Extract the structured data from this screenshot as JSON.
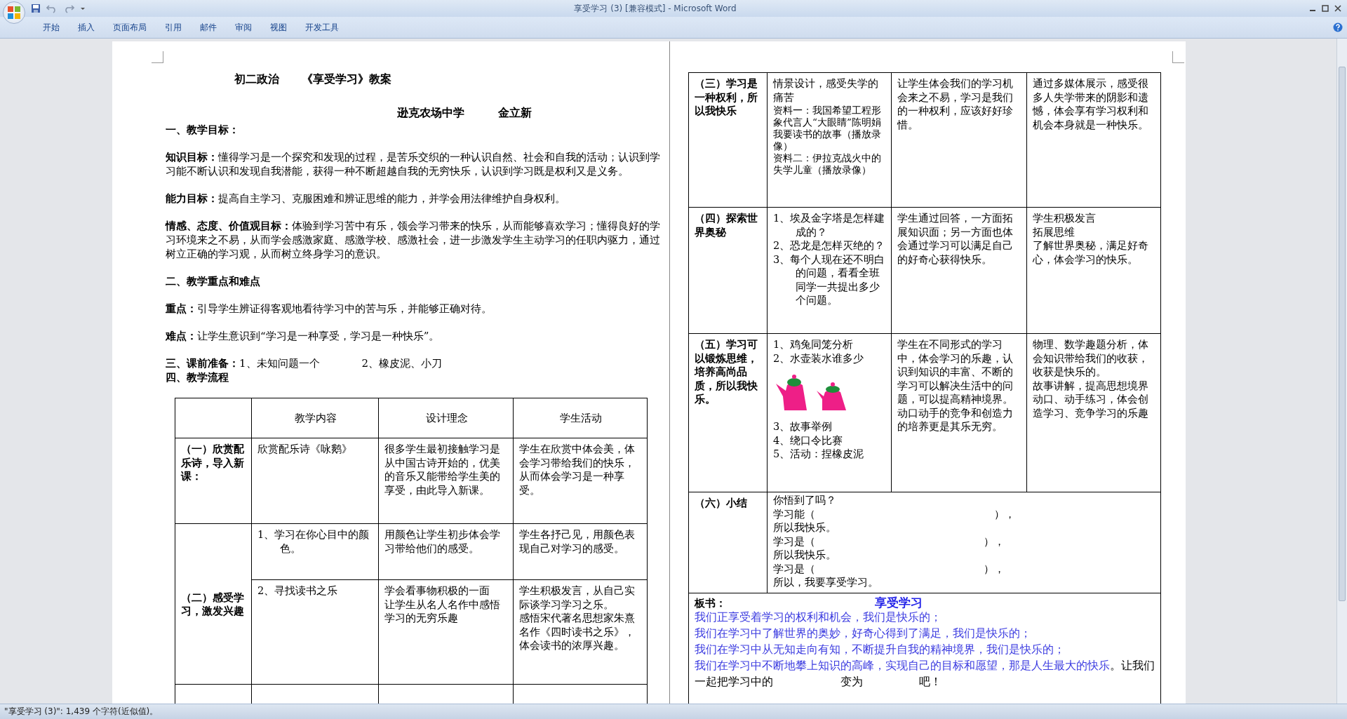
{
  "window": {
    "title": "享受学习 (3) [兼容模式] - Microsoft Word"
  },
  "ribbon_tabs": [
    {
      "label": "开始",
      "selected": false
    },
    {
      "label": "插入",
      "selected": false
    },
    {
      "label": "页面布局",
      "selected": false
    },
    {
      "label": "引用",
      "selected": false
    },
    {
      "label": "邮件",
      "selected": false
    },
    {
      "label": "审阅",
      "selected": false
    },
    {
      "label": "视图",
      "selected": false
    },
    {
      "label": "开发工具",
      "selected": false
    }
  ],
  "document": {
    "title": "初二政治　　《享受学习》教案",
    "byline": "逊克农场中学　　　金立新",
    "paragraphs": [
      {
        "kind": "section",
        "text": "一、教学目标："
      },
      {
        "kind": "para",
        "text": "**知识目标：**懂得学习是一个探究和发现的过程，是苦乐交织的一种认识自然、社会和自我的活动；认识到学习能不断认识和发现自我潜能，获得一种不断超越自我的无穷快乐，认识到学习既是权利又是义务。"
      },
      {
        "kind": "para",
        "text": "**能力目标：**提高自主学习、克服困难和辨证思维的能力，并学会用法律维护自身权利。"
      },
      {
        "kind": "para",
        "text": "**情感、态度、价值观目标：**体验到学习苦中有乐，领会学习带来的快乐，从而能够喜欢学习；懂得良好的学习环境来之不易，从而学会感激家庭、感激学校、感激社会，进一步激发学生主动学习的任职内驱力，通过树立正确的学习观，从而树立终身学习的意识。"
      },
      {
        "kind": "section",
        "text": "二、教学重点和难点"
      },
      {
        "kind": "para",
        "text": "**重点：**引导学生辨证得客观地看待学习中的苦与乐，并能够正确对待。"
      },
      {
        "kind": "para",
        "text": "**难点：**让学生意识到“学习是一种享受，学习是一种快乐”。"
      },
      {
        "kind": "tight",
        "text": "**三、课前准备：**1、未知问题一个　　　　2、橡皮泥、小刀"
      },
      {
        "kind": "section",
        "text": "四、教学流程"
      }
    ]
  },
  "lesson_table": {
    "columns": [
      "教学内容",
      "设计理念",
      "学生活动"
    ],
    "stages": [
      {
        "stage": "（一）欣赏配乐诗，导入新课：",
        "steps": [
          {
            "content": [
              {
                "kind": "para",
                "text": "欣赏配乐诗《咏鹅》"
              }
            ],
            "idea": [
              "很多学生最初接触学习是从中国古诗开始的，优美的音乐又能带给学生美的享受，由此导入新课。"
            ],
            "activity": [
              "学生在欣赏中体会美，体会学习带给我们的快乐，从而体会学习是一种享受。"
            ]
          }
        ]
      },
      {
        "stage": "（二）感受学习，激发兴趣",
        "steps": [
          {
            "content": [
              {
                "kind": "num",
                "text": "1、学习在你心目中的颜色。"
              }
            ],
            "idea": [
              "用颜色让学生初步体会学习带给他们的感受。"
            ],
            "activity": [
              "学生各抒己见，用颜色表现自己对学习的感受。"
            ]
          },
          {
            "content": [
              {
                "kind": "num",
                "text": "2、寻找读书之乐"
              }
            ],
            "idea": [
              "学会看事物积极的一面",
              "让学生从名人名作中感悟学习的无穷乐趣"
            ],
            "activity": [
              "学生积极发言，从自己实际谈学习学习之乐。",
              "感悟宋代著名思想家朱熹名作《四时读书之乐》，体会读书的浓厚兴趣。"
            ]
          }
        ]
      }
    ]
  },
  "lesson_table_continued": {
    "stages": [
      {
        "stage": "（三）学习是一种权利，所以我快乐",
        "steps": [
          {
            "content": [
              {
                "kind": "para",
                "text": "情景设计，感受失学的痛苦"
              },
              {
                "kind": "note",
                "text": "资料一：我国希望工程形象代言人“大眼睛”陈明娟我要读书的故事（播放录像）"
              },
              {
                "kind": "note",
                "text": "资料二：伊拉克战火中的失学儿童（播放录像）"
              }
            ],
            "idea": [
              "让学生体会我们的学习机会来之不易，学习是我们的一种权利，应该好好珍惜。"
            ],
            "activity": [
              "通过多媒体展示，感受很多人失学带来的阴影和遗憾，体会享有学习权利和机会本身就是一种快乐。"
            ]
          }
        ]
      },
      {
        "stage": "（四）探索世界奥秘",
        "steps": [
          {
            "content": [
              {
                "kind": "num",
                "text": "1、埃及金字塔是怎样建成的？"
              },
              {
                "kind": "num",
                "text": "2、恐龙是怎样灭绝的？"
              },
              {
                "kind": "num",
                "text": "3、每个人现在还不明白的问题，看看全班同学一共提出多少个问题。"
              }
            ],
            "idea": [
              "学生通过回答，一方面拓展知识面；另一方面也体会通过学习可以满足自己的好奇心获得快乐。"
            ],
            "activity": [
              "学生积极发言",
              "拓展思维",
              "了解世界奥秘，满足好奇心，体会学习的快乐。"
            ]
          }
        ]
      },
      {
        "stage": "（五）学习可以锻炼思维，培养高尚品质，所以我快乐。",
        "steps": [
          {
            "content": [
              {
                "kind": "para",
                "text": "1、鸡兔同笼分析"
              },
              {
                "kind": "para",
                "text": "2、水壶装水谁多少"
              },
              {
                "kind": "picture"
              },
              {
                "kind": "para",
                "text": "3、故事举例"
              },
              {
                "kind": "para",
                "text": "4、绕口令比赛"
              },
              {
                "kind": "para",
                "text": "5、活动：捏橡皮泥"
              }
            ],
            "idea": [
              "学生在不同形式的学习中，体会学习的乐趣，认识到知识的丰富、不断的学习可以解决生活中的问题，可以提高精神境界。动口动手的竞争和创造力的培养更是其乐无穷。"
            ],
            "activity": [
              "物理、数学趣题分析，体会知识带给我们的收获，收获是快乐的。",
              "故事讲解，提高思想境界",
              "动口、动手练习，体会创造学习、竞争学习的乐趣"
            ]
          }
        ]
      }
    ],
    "summary": {
      "stage": "（六）小结",
      "lines": [
        "你悟到了吗？",
        "学习能（　　　　　　　　　　　　　　　　　），",
        "所以我快乐。",
        "学习是（　　　　　　　　　　　　　　　　），",
        "所以我快乐。",
        "学习是（　　　　　　　　　　　　　　　　），",
        "所以，我要享受学习。"
      ]
    },
    "board": {
      "label": "板书：",
      "title": "享受学习",
      "segments": [
        {
          "text": "我们正享受着学习的权利和机会，我们是快乐的；",
          "highlight": true,
          "newline": true
        },
        {
          "text": "我们在学习中了解世界的奥妙，好奇心得到了满足，我们是快乐的；",
          "highlight": true,
          "newline": true
        },
        {
          "text": "我们在学习中从无知走向有知，不断提升自我的精神境界，我们是快乐的；",
          "highlight": true,
          "newline": true
        },
        {
          "text": "我们在学习中不断地攀上知识的高峰，实现自己的目标和愿望，那是人生最大的快乐",
          "highlight": true,
          "newline": false
        },
        {
          "text": "。让我们一起把学习中的　　　　　　变为　　　　　吧！",
          "highlight": false
        }
      ]
    }
  },
  "status_bar": {
    "text": "\"享受学习 (3)\": 1,439 个字符(近似值)。"
  }
}
